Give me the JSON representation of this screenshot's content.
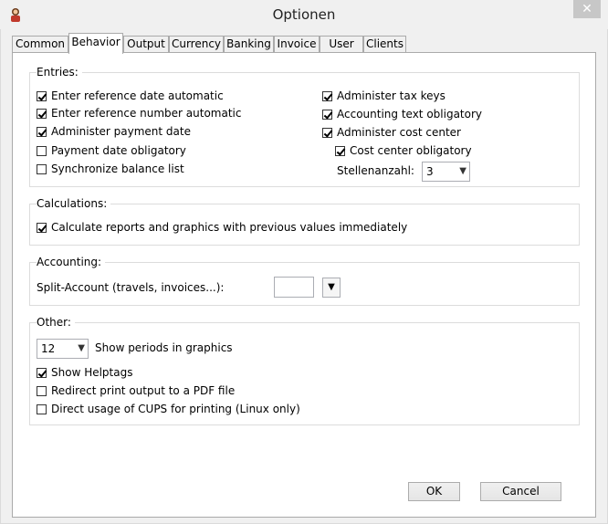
{
  "window": {
    "title": "Optionen",
    "close_glyph": "✕"
  },
  "tabs": [
    {
      "label": "Common"
    },
    {
      "label": "Behavior"
    },
    {
      "label": "Output"
    },
    {
      "label": "Currency"
    },
    {
      "label": "Banking"
    },
    {
      "label": "Invoice"
    },
    {
      "label": "User"
    },
    {
      "label": "Clients"
    }
  ],
  "entries": {
    "label": "Entries:",
    "left": [
      {
        "label": "Enter reference date automatic",
        "checked": true
      },
      {
        "label": "Enter reference number automatic",
        "checked": true
      },
      {
        "label": "Administer payment date",
        "checked": true
      },
      {
        "label": "Payment date obligatory",
        "checked": false
      },
      {
        "label": "Synchronize balance list",
        "checked": false
      }
    ],
    "right": [
      {
        "label": "Administer tax keys",
        "checked": true
      },
      {
        "label": "Accounting text obligatory",
        "checked": true
      },
      {
        "label": "Administer cost center",
        "checked": true
      },
      {
        "label": "Cost center obligatory",
        "checked": true
      }
    ],
    "stellen_label": "Stellenanzahl:",
    "stellen_value": "3"
  },
  "calculations": {
    "label": "Calculations:",
    "option": {
      "label": "Calculate reports and graphics with previous values immediately",
      "checked": true
    }
  },
  "accounting": {
    "label": "Accounting:",
    "split_label": "Split-Account (travels, invoices...):",
    "split_value": ""
  },
  "other": {
    "label": "Other:",
    "periods_value": "12",
    "periods_label": "Show periods in graphics",
    "options": [
      {
        "label": "Show Helptags",
        "checked": true
      },
      {
        "label": "Redirect print output to a PDF file",
        "checked": false
      },
      {
        "label": "Direct usage of CUPS for printing (Linux only)",
        "checked": false
      }
    ]
  },
  "buttons": {
    "ok": "OK",
    "cancel": "Cancel"
  },
  "icons": {
    "dropdown": "chevron-down-icon",
    "check": "check-icon",
    "app": "app-icon"
  }
}
